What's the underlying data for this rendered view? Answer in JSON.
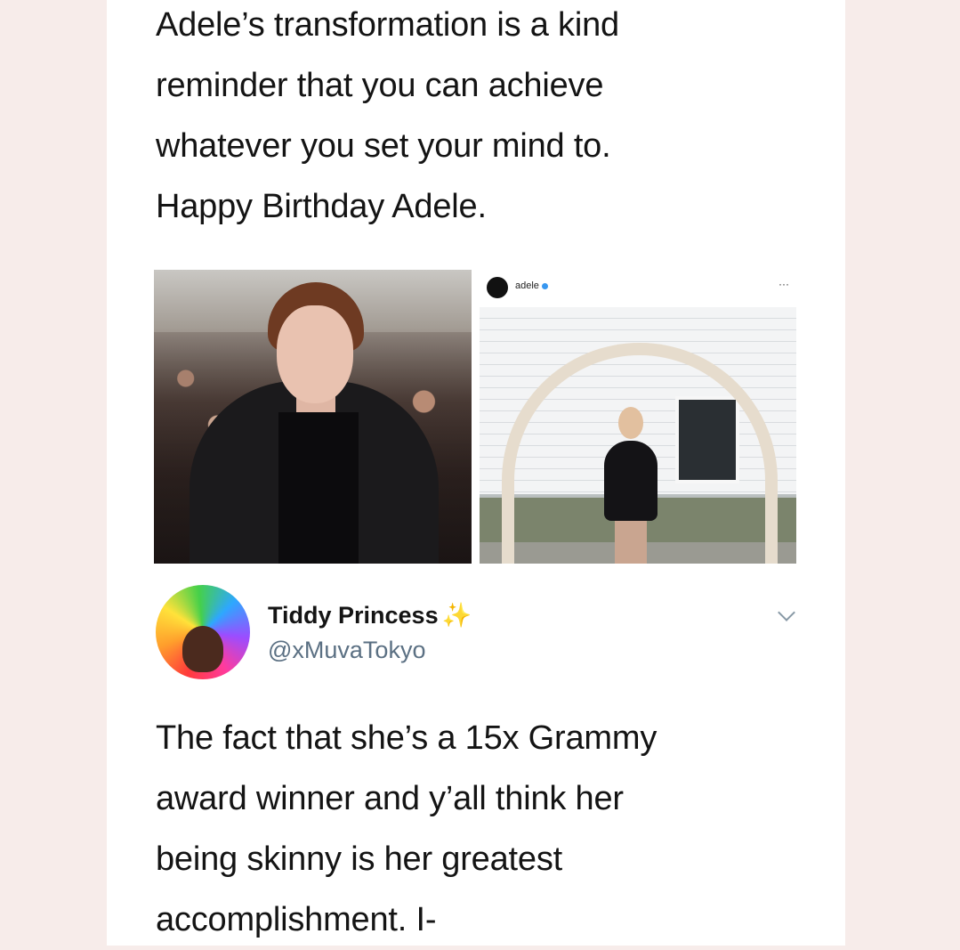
{
  "quoted_tweet": {
    "text_lines": [
      "Adele’s transformation is a kind",
      "reminder that you can achieve",
      "whatever you set your mind to.",
      "Happy Birthday Adele."
    ]
  },
  "instagram_post": {
    "username": "adele",
    "more_label": "···"
  },
  "reply": {
    "display_name": "Tiddy Princess",
    "name_emoji": "✨",
    "handle": "@xMuvaTokyo",
    "text_lines": [
      "The fact that she’s a 15x Grammy",
      "award winner and y’all think her",
      "being skinny is her greatest",
      "accomplishment. I-"
    ]
  },
  "colors": {
    "page_background": "#f7ecea",
    "text": "#141414",
    "handle": "#5b7083",
    "verified": "#3897f0"
  },
  "icons": {
    "sparkle": "sparkles-icon",
    "menu": "chevron-down-icon",
    "verified": "verified-badge-icon"
  }
}
